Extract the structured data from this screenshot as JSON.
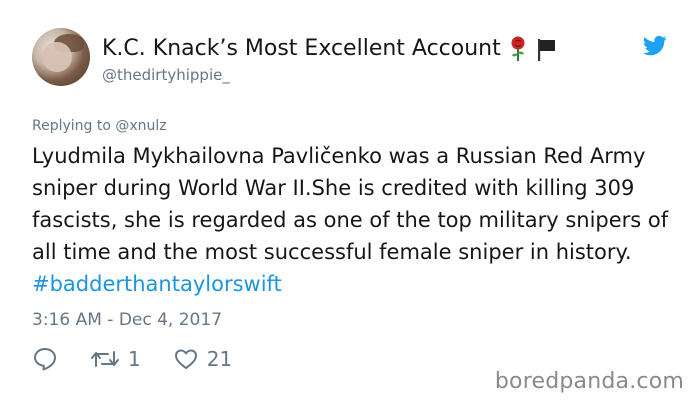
{
  "tweet": {
    "display_name": "K.C. Knack’s Most Excellent Account",
    "handle": "@thedirtyhippie_",
    "replying_to_label": "Replying to",
    "replying_to_handle": "@xnulz",
    "text": "Lyudmila Mykhailovna Pavličenko was a Russian Red Army sniper during World War II.She is credited with killing 309 fascists, she is regarded as one of the top military snipers of all time and the most successful female sniper in history.",
    "hashtag": "#badderthantaylorswift",
    "timestamp": "3:16 AM - Dec 4, 2017",
    "retweet_count": "1",
    "like_count": "21"
  },
  "icons": {
    "name_emoji_1": "rose-icon",
    "name_emoji_2": "black-flag-icon",
    "brand": "twitter-bird-icon",
    "reply": "reply-icon",
    "retweet": "retweet-icon",
    "like": "heart-icon"
  },
  "colors": {
    "text": "#14171a",
    "secondary": "#657786",
    "link": "#1b95e0",
    "twitter_blue": "#1da1f2"
  },
  "watermark": "boredpanda.com"
}
